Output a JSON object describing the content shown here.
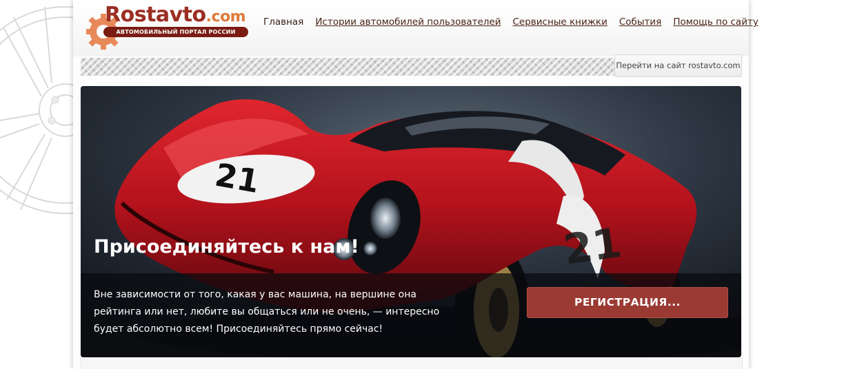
{
  "logo": {
    "title": "Rostavto",
    "domain": ".com",
    "subtitle": "АВТОМОБИЛЬНЫЙ ПОРТАЛ РОССИИ"
  },
  "nav": {
    "items": [
      {
        "label": "Главная"
      },
      {
        "label": "Истории автомобилей пользователей"
      },
      {
        "label": "Сервисные книжки"
      },
      {
        "label": "События"
      },
      {
        "label": "Помощь по сайту"
      }
    ]
  },
  "goto_button": "Перейти на сайт rostavto.com",
  "hero": {
    "title": "Присоединяйтесь к нам!",
    "text": "Вне зависимости от того, какая у вас машина, на вершине она рейтинга или нет, любите вы общаться или не очень, — интересно будет абсолютно всем! Присоединяйтесь прямо сейчас!",
    "button": "РЕГИСТРАЦИЯ...",
    "car_number": "21"
  },
  "colors": {
    "logo_red": "#9b2e22",
    "logo_orange": "#e07a3a",
    "button_red": "#9a3a33",
    "car_red": "#b3121c"
  }
}
